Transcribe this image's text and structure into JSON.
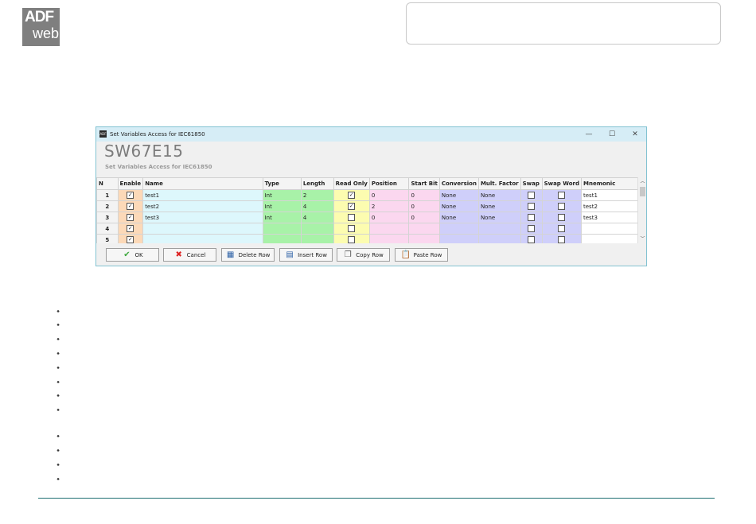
{
  "logo": {
    "line1": "ADF",
    "line2": "web"
  },
  "window": {
    "title": "Set Variables Access for IEC61850",
    "icon_text": "ADF",
    "controls": {
      "minimize": "—",
      "maximize": "☐",
      "close": "✕"
    },
    "heading": "SW67E15",
    "subheading": "Set Variables Access for IEC61850"
  },
  "grid": {
    "columns": [
      "N",
      "Enable",
      "Name",
      "Type",
      "Length",
      "Read Only",
      "Position",
      "Start Bit",
      "Conversion",
      "Mult. Factor",
      "Swap",
      "Swap Word",
      "Mnemonic"
    ],
    "rows": [
      {
        "n": "1",
        "enable": true,
        "name": "test1",
        "type": "Int",
        "length": "2",
        "read_only": true,
        "position": "0",
        "start_bit": "0",
        "conversion": "None",
        "mult_factor": "None",
        "swap": false,
        "swap_word": false,
        "mnemonic": "test1"
      },
      {
        "n": "2",
        "enable": true,
        "name": "test2",
        "type": "Int",
        "length": "4",
        "read_only": true,
        "position": "2",
        "start_bit": "0",
        "conversion": "None",
        "mult_factor": "None",
        "swap": false,
        "swap_word": false,
        "mnemonic": "test2"
      },
      {
        "n": "3",
        "enable": true,
        "name": "test3",
        "type": "Int",
        "length": "4",
        "read_only": false,
        "position": "0",
        "start_bit": "0",
        "conversion": "None",
        "mult_factor": "None",
        "swap": false,
        "swap_word": false,
        "mnemonic": "test3"
      },
      {
        "n": "4",
        "enable": true,
        "name": "",
        "type": "",
        "length": "",
        "read_only": false,
        "position": "",
        "start_bit": "",
        "conversion": "",
        "mult_factor": "",
        "swap": false,
        "swap_word": false,
        "mnemonic": ""
      },
      {
        "n": "5",
        "enable": true,
        "name": "",
        "type": "",
        "length": "",
        "read_only": false,
        "position": "",
        "start_bit": "",
        "conversion": "",
        "mult_factor": "",
        "swap": false,
        "swap_word": false,
        "mnemonic": ""
      }
    ]
  },
  "buttons": {
    "ok": "OK",
    "cancel": "Cancel",
    "delete_row": "Delete Row",
    "insert_row": "Insert Row",
    "copy_row": "Copy Row",
    "paste_row": "Paste Row"
  },
  "icons": {
    "ok": "check-icon",
    "cancel": "x-icon",
    "delete_row": "delete-row-icon",
    "insert_row": "insert-row-icon",
    "copy_row": "copy-icon",
    "paste_row": "paste-icon",
    "bullet": "arrow-bullet-icon"
  },
  "colors": {
    "name": "#ddf7fc",
    "enable": "#fcd9b8",
    "type_length": "#a8f2a8",
    "read_only": "#fcfcb0",
    "position": "#fbd7ef",
    "conversion": "#cfcffa",
    "rule": "#1e6f72"
  },
  "bullet_symbol": "➧",
  "bullet_count": 12
}
